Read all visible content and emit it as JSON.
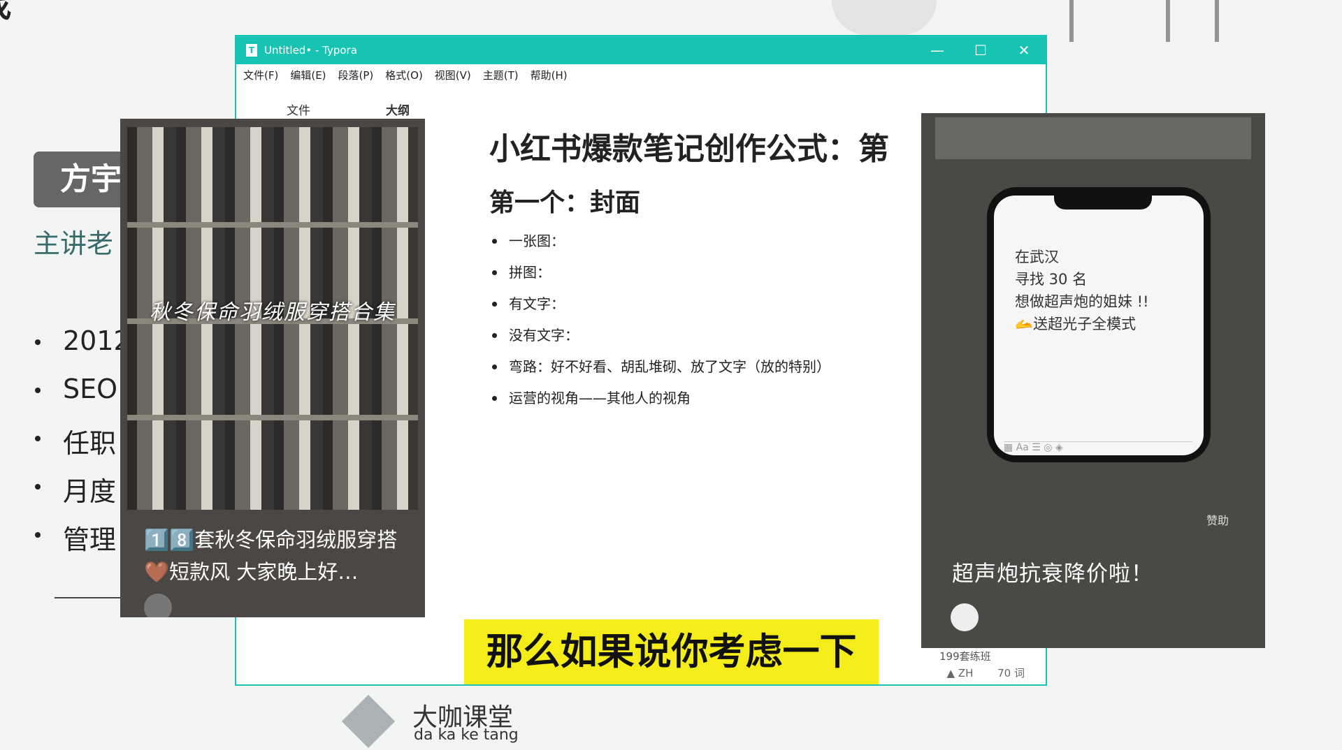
{
  "slide": {
    "title": "找",
    "badge": "方宇",
    "presenter": "主讲老",
    "bullets": [
      "2012",
      "SEO",
      "任职",
      "月度",
      "管理"
    ]
  },
  "window": {
    "title": "Untitled• - Typora",
    "controls": {
      "minimize": "—",
      "maximize": "☐",
      "close": "✕"
    },
    "menu": [
      "文件(F)",
      "编辑(E)",
      "段落(P)",
      "格式(O)",
      "视图(V)",
      "主题(T)",
      "帮助(H)"
    ],
    "side_tabs": {
      "files": "文件",
      "outline": "大纲"
    },
    "document": {
      "h1": "小红书爆款笔记创作公式：第",
      "h2": "第一个：封面",
      "items": [
        "一张图：",
        "拼图：",
        "有文字：",
        "没有文字：",
        "弯路：好不好看、胡乱堆砌、放了文字（放的特别）",
        "运营的视角——其他人的视角"
      ]
    },
    "status": {
      "lang": "▲ ZH",
      "words": "70 词"
    }
  },
  "left_card": {
    "caption": "秋冬保命羽绒服穿搭合集",
    "desc": "1️⃣8️⃣套秋冬保命羽绒服穿搭🤎短款风 大家晚上好…"
  },
  "right_card": {
    "phone_lines": [
      "在武汉",
      "寻找 30 名",
      "想做超声炮的姐妹 !!",
      "🫴送超光子全模式"
    ],
    "keybar": "▦  Aa  ☰  ◎  ◈",
    "side_label": "赞助",
    "title": "超声炮抗衰降价啦！",
    "footer": "199套练班"
  },
  "subtitle": "那么如果说你考虑一下",
  "brand": {
    "name": "大咖课堂",
    "pinyin": "da ka ke tang"
  }
}
